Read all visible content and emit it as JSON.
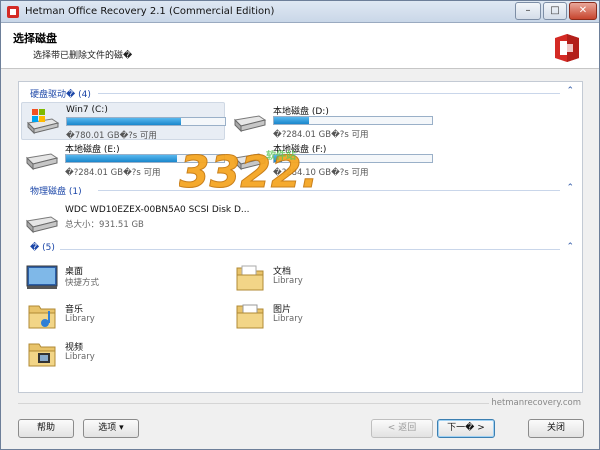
{
  "window": {
    "title": "Hetman Office Recovery 2.1 (Commercial Edition)",
    "min": "–",
    "max": "□",
    "close": "✕"
  },
  "header": {
    "title": "选择磁盘",
    "subtitle": "选择带已删除文件的磁�"
  },
  "groups": {
    "hard": "硬盘驱动� (4)",
    "physical": "物理磁盘 (1)",
    "other": "� (5)"
  },
  "drives": [
    {
      "name": "Win7 (C:)",
      "free": "�780.01 GB�?s 可用",
      "used": 0.72
    },
    {
      "name": "本地磁盘 (D:)",
      "free": "�?284.01 GB�?s 可用",
      "used": 0.22
    },
    {
      "name": "本地磁盘 (E:)",
      "free": "�?284.01 GB�?s 可用",
      "used": 0.7
    },
    {
      "name": "本地磁盘 (F:)",
      "free": "�?284.10 GB�?s 可用",
      "used": 0.05
    }
  ],
  "physical_disk": {
    "name": "WDC WD10EZEX-00BN5A0 SCSI Disk D...",
    "size": "总大小：931.51 GB"
  },
  "folders": [
    {
      "name": "桌面",
      "sub": "快捷方式"
    },
    {
      "name": "文档",
      "sub": "Library"
    },
    {
      "name": "音乐",
      "sub": "Library"
    },
    {
      "name": "图片",
      "sub": "Library"
    },
    {
      "name": "视频",
      "sub": "Library"
    }
  ],
  "watermark": {
    "text": "3322.cc",
    "green": "软件站"
  },
  "footer": {
    "site": "hetmanrecovery.com",
    "help": "帮助",
    "options": "选项 ▾",
    "back": "< 返回",
    "next": "下一� >",
    "close": "关闭"
  },
  "colors": {
    "accent": "#1b46a8",
    "bar": "#1a86cc",
    "logo": "#d42a24"
  }
}
